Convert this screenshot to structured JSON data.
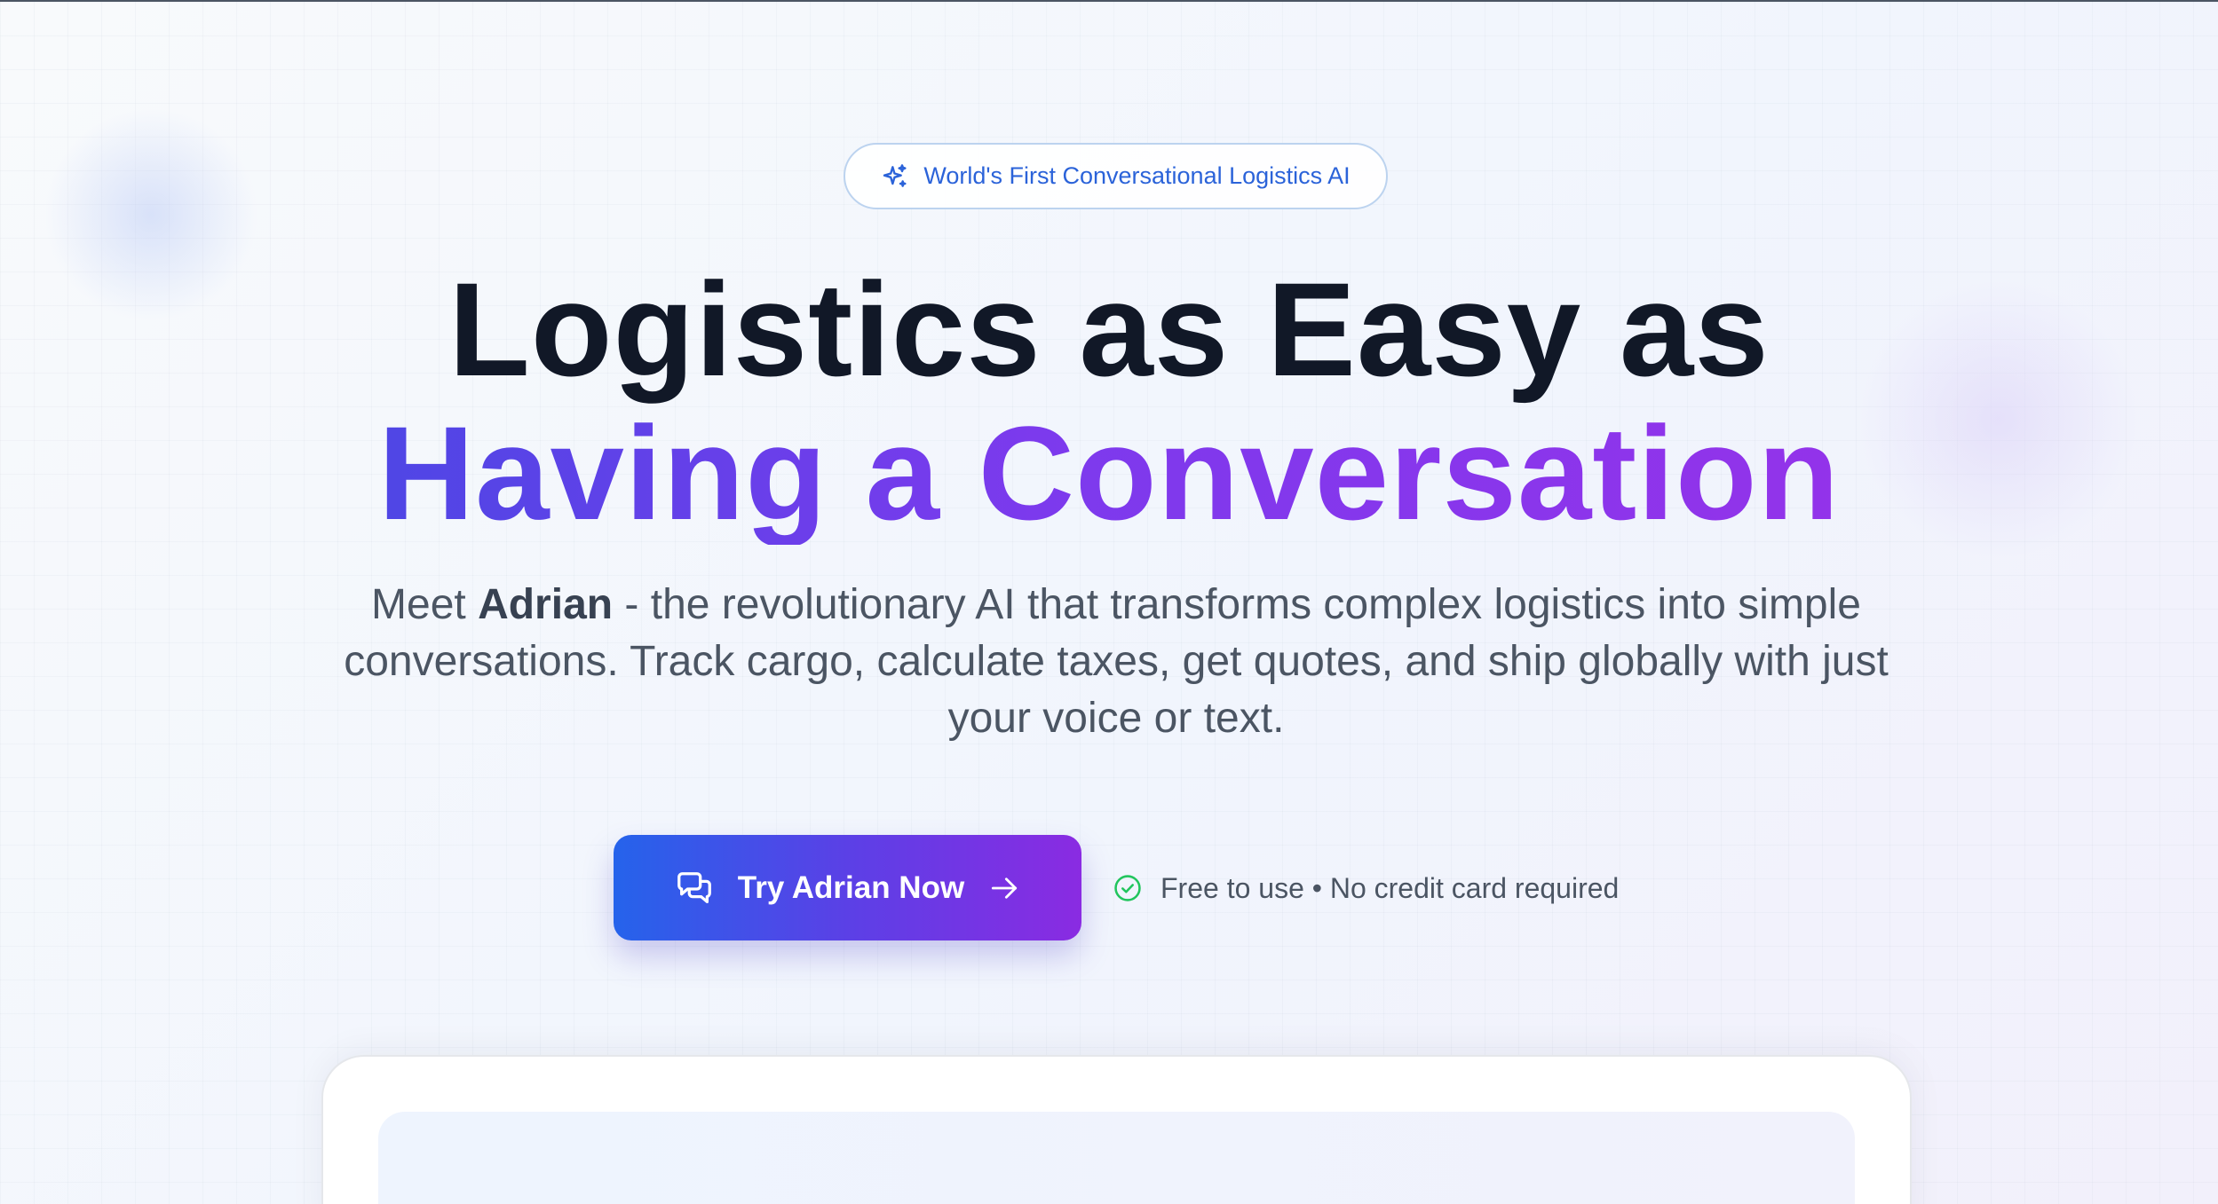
{
  "badge": {
    "icon": "sparkles-icon",
    "text": "World's First Conversational Logistics AI"
  },
  "headline": {
    "line1": "Logistics as Easy as",
    "line2": "Having a Conversation"
  },
  "subtitle": {
    "prefix": "Meet ",
    "name": "Adrian",
    "rest": " - the revolutionary AI that transforms complex logistics into simple conversations. Track cargo, calculate taxes, get quotes, and ship globally with just your voice or text."
  },
  "cta": {
    "icon": "chat-bubbles-icon",
    "label": "Try Adrian Now",
    "trailing_icon": "arrow-right-icon"
  },
  "note": {
    "icon": "check-circle-icon",
    "text": "Free to use • No credit card required"
  },
  "colors": {
    "accent_blue": "#2563eb",
    "accent_purple": "#9333ea",
    "heading": "#111827",
    "body_text": "#4b5563",
    "success_green": "#22c55e",
    "badge_text": "#2b63d9"
  }
}
